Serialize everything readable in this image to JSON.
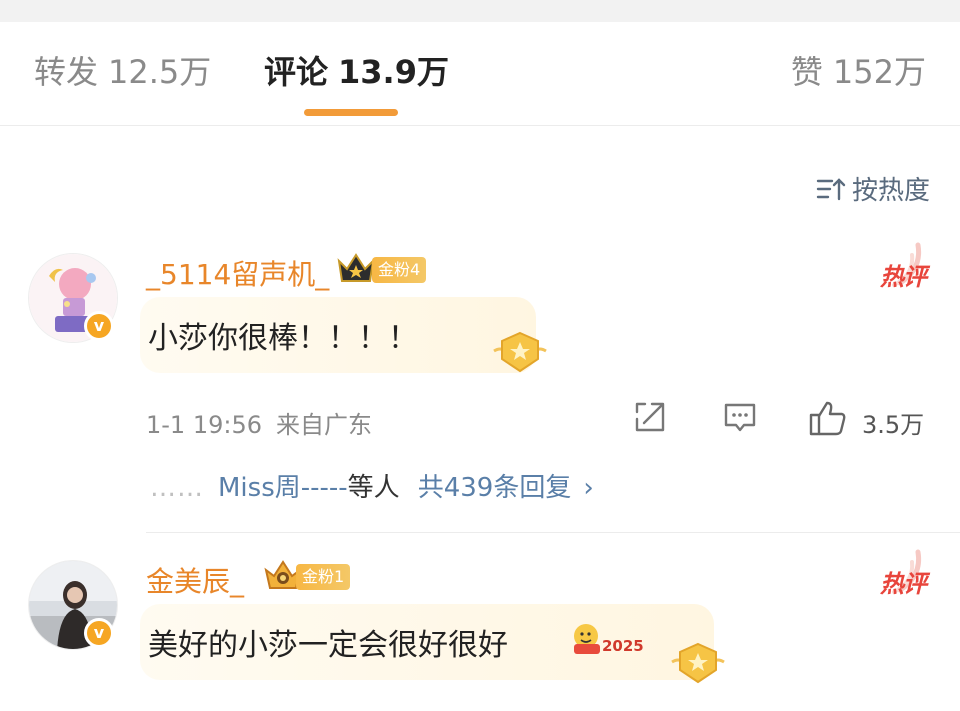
{
  "tabs": {
    "forward_label": "转发",
    "forward_count": "12.5万",
    "comments_label": "评论",
    "comments_count": "13.9万",
    "likes_label": "赞",
    "likes_count": "152万"
  },
  "sort": {
    "label": "按热度",
    "icon": "sort-icon"
  },
  "comments": [
    {
      "username": "_5114留声机_",
      "fan_badge": "金粉4",
      "hot_label": "热评",
      "text": "小莎你很棒！！！！",
      "time": "1-1 19:56",
      "source": "来自广东",
      "like_count": "3.5万",
      "reply_preview": {
        "dots": "……",
        "name": "Miss周-----",
        "others": "等人",
        "total": "共439条回复",
        "chevron": "›"
      }
    },
    {
      "username": "金美辰_",
      "fan_badge": "金粉1",
      "hot_label": "热评",
      "text": "美好的小莎一定会很好很好",
      "emoji_text": "2025"
    }
  ],
  "colors": {
    "accent": "#f29b39",
    "username": "#e8862a",
    "link": "#5a7fa8",
    "hot": "#e8453c"
  }
}
